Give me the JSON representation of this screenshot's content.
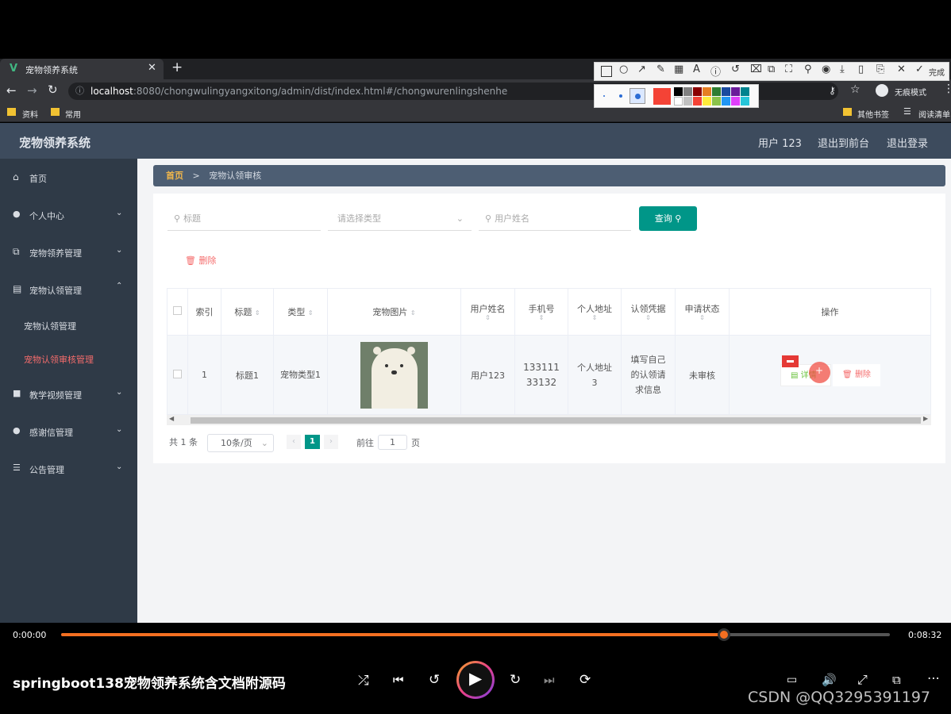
{
  "browser": {
    "tab_title": "宠物领养系统",
    "tab_plus": "+",
    "url_host": "localhost",
    "url_rest": ":8080/chongwulingyangxitong/admin/dist/index.html#/chongwurenlingshenhe",
    "incognito": "无痕模式",
    "bookmarks": [
      "资料",
      "常用"
    ],
    "bookmarks_right": [
      "其他书签",
      "阅读清单"
    ]
  },
  "snip_toolbar": {
    "done_label": "完成"
  },
  "app": {
    "title": "宠物领养系统",
    "user": "用户 123",
    "to_front": "退出到前台",
    "logout": "退出登录"
  },
  "sidebar": {
    "items": [
      {
        "label": "首页"
      },
      {
        "label": "个人中心"
      },
      {
        "label": "宠物领养管理"
      },
      {
        "label": "宠物认领管理"
      },
      {
        "label": "宠物认领管理"
      },
      {
        "label": "宠物认领审核管理"
      },
      {
        "label": "教学视频管理"
      },
      {
        "label": "感谢信管理"
      },
      {
        "label": "公告管理"
      }
    ]
  },
  "breadcrumb": {
    "home": "首页",
    "sep": ">",
    "current": "宠物认领审核"
  },
  "search": {
    "title_placeholder": "标题",
    "type_placeholder": "请选择类型",
    "user_placeholder": "用户姓名",
    "query_label": "查询"
  },
  "delete_label": "删除",
  "table": {
    "headers": [
      "索引",
      "标题",
      "类型",
      "宠物图片",
      "用户姓名",
      "手机号",
      "个人地址",
      "认领凭据",
      "申请状态",
      "操作"
    ],
    "row": {
      "index": "1",
      "title": "标题1",
      "type": "宠物类型1",
      "username": "用户123",
      "phone": "13311133132",
      "address": "个人地址3",
      "proof": "填写自己的认领请求信息",
      "status": "未审核",
      "detail": "详情",
      "delete": "删除"
    }
  },
  "pagination": {
    "total": "共 1 条",
    "page_size": "10条/页",
    "current_page": "1",
    "goto_prefix": "前往",
    "goto_value": "1",
    "goto_suffix": "页"
  },
  "player": {
    "elapsed": "0:00:00",
    "duration": "0:08:32",
    "progress": 0.8,
    "video_title": "springboot138宠物领养系统含文档附源码",
    "watermark": "CSDN @QQ3295391197"
  },
  "colors": {
    "accent": "#009688",
    "sidebar_bg": "#2f3a47",
    "danger": "#f56c6c",
    "progress": "#f36f21"
  }
}
